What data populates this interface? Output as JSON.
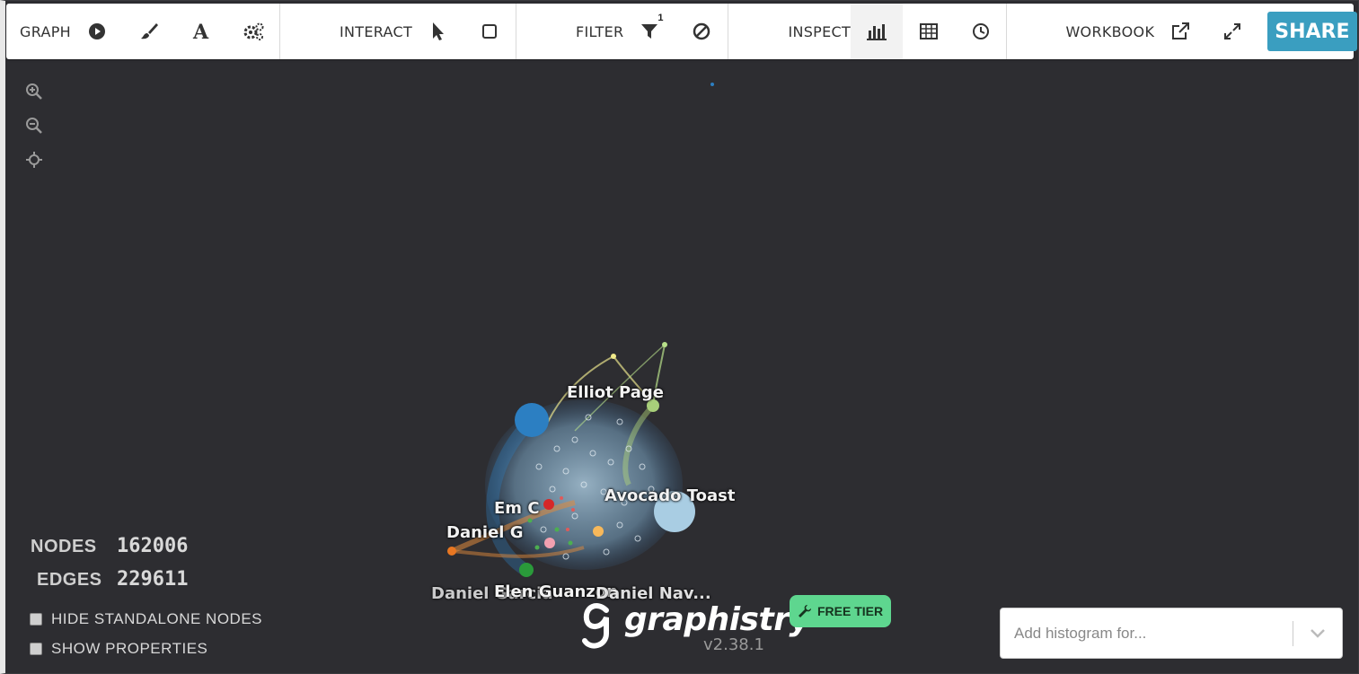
{
  "toolbar": {
    "graph_label": "GRAPH",
    "interact_label": "INTERACT",
    "filter_label": "FILTER",
    "filter_badge": "1",
    "inspect_label": "INSPECT",
    "workbook_label": "WORKBOOK",
    "share_label": "SHARE"
  },
  "node_labels": {
    "elliot": "Elliot Page",
    "avocado": "Avocado Toast",
    "emc": "Em C",
    "danielg": "Daniel G",
    "danielgarcia": "Daniel Garcia",
    "elen": "Elen Guanzon",
    "danielnav": "Daniel Nav..."
  },
  "stats": {
    "nodes_label": "NODES",
    "nodes_value": "162006",
    "edges_label": "EDGES",
    "edges_value": "229611"
  },
  "options": {
    "hide_standalone": "HIDE STANDALONE NODES",
    "show_properties": "SHOW PROPERTIES"
  },
  "branding": {
    "logo_text": "graphistry",
    "version": "v2.38.1",
    "free_tier": "FREE TIER"
  },
  "histogram": {
    "placeholder": "Add histogram for..."
  },
  "colors": {
    "background": "#2d2d31",
    "share": "#3a9ec0",
    "free_tier": "#5ed68f"
  }
}
